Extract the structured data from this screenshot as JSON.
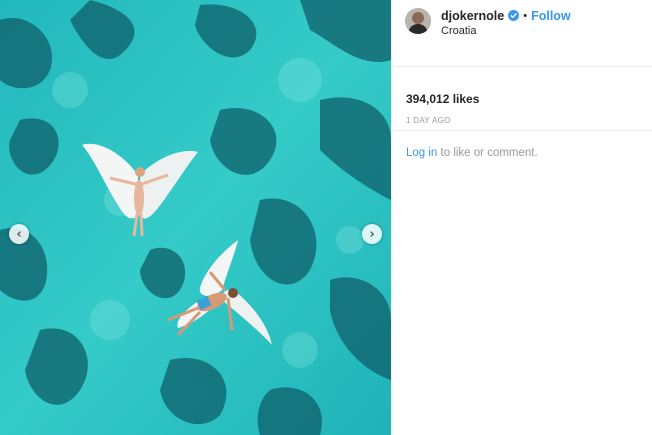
{
  "post": {
    "username": "djokernole",
    "separator": "•",
    "follow_label": "Follow",
    "location": "Croatia",
    "likes": "394,012 likes",
    "timestamp": "1 DAY AGO",
    "login_link": "Log in",
    "login_suffix": " to like or comment."
  },
  "carousel": {
    "prev_glyph": "‹",
    "next_glyph": "›"
  },
  "icons": {
    "avatar": "avatar",
    "verified": "verified-badge-icon",
    "prev": "chevron-left-icon",
    "next": "chevron-right-icon"
  },
  "colors": {
    "link_blue": "#3897f0",
    "text": "#262626",
    "muted": "#999999",
    "water": "#2ec4c4"
  }
}
